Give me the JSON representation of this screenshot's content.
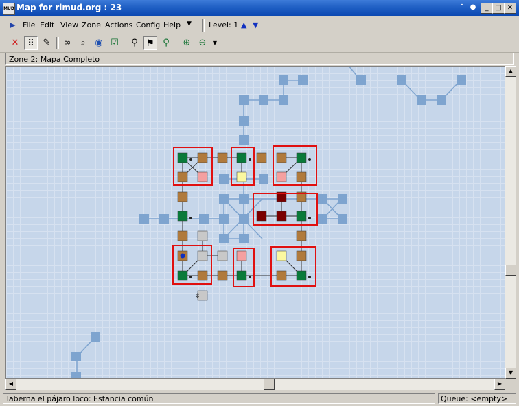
{
  "window": {
    "title": "Map for rlmud.org : 23"
  },
  "menu": {
    "items": [
      "File",
      "Edit",
      "View",
      "Zone",
      "Actions",
      "Config",
      "Help"
    ],
    "level_label": "Level: 1"
  },
  "zone": {
    "label": "Zone 2: Mapa Completo"
  },
  "status": {
    "left": "Taberna el pájaro loco: Estancia común",
    "right": "Queue:  <empty>"
  },
  "icons": [
    "app-icon",
    "play-icon",
    "delete-icon",
    "grid-icon",
    "auto-map-icon",
    "binoculars-icon",
    "magnifier-icon",
    "globe-icon",
    "check-icon",
    "walker-icon",
    "walker-path-icon",
    "walker-follow-icon",
    "zoom-in-icon",
    "zoom-out-icon"
  ],
  "colors": {
    "dim_room": "#7ea4cf",
    "green_room": "#0a7a3a",
    "brown_room": "#b07a3c",
    "pink_room": "#f4a0a0",
    "yellow_room": "#fbf8a0",
    "gray_room": "#c8c8c8",
    "darkred_room": "#7a0000",
    "highlight": "#e01010"
  }
}
